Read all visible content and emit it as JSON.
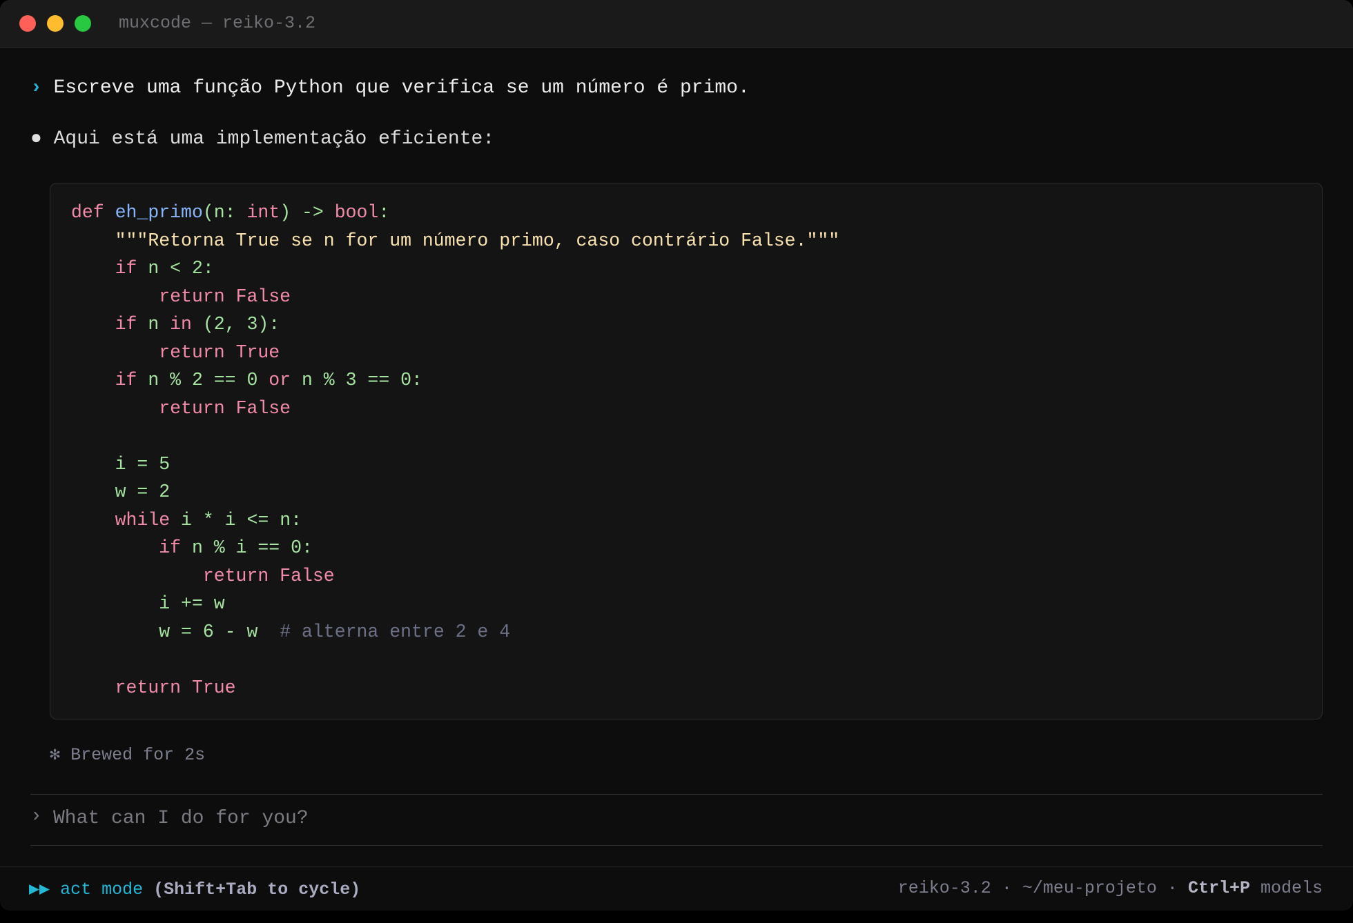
{
  "window": {
    "title": "muxcode — reiko-3.2"
  },
  "conversation": {
    "user_prompt_glyph": "›",
    "user_message": "Escreve uma função Python que verifica se um número é primo.",
    "assistant_bullet": "●",
    "assistant_message": "Aqui está uma implementação eficiente:",
    "code_language": "python",
    "code_lines": [
      "def eh_primo(n: int) -> bool:",
      "    \"\"\"Retorna True se n for um número primo, caso contrário False.\"\"\"",
      "    if n < 2:",
      "        return False",
      "    if n in (2, 3):",
      "        return True",
      "    if n % 2 == 0 or n % 3 == 0:",
      "        return False",
      "",
      "    i = 5",
      "    w = 2",
      "    while i * i <= n:",
      "        if n % i == 0:",
      "            return False",
      "        i += w",
      "        w = 6 - w  # alterna entre 2 e 4",
      "",
      "    return True"
    ],
    "status_icon": "✻",
    "status_text": "Brewed for 2s"
  },
  "input": {
    "caret": "›",
    "placeholder": "What can I do for you?",
    "value": ""
  },
  "statusbar": {
    "mode_icon": "▶▶",
    "mode_label": "act mode",
    "mode_hint": "(Shift+Tab to cycle)",
    "model": "reiko-3.2",
    "separator": "·",
    "path": "~/meu-projeto",
    "shortcut": "Ctrl+P",
    "shortcut_label": "models"
  },
  "colors": {
    "accent": "#22b8d6",
    "keyword": "#f38ba8",
    "function": "#89b4fa",
    "string": "#f9e2af",
    "code_default": "#a6e3a1",
    "comment": "#6c7086"
  }
}
